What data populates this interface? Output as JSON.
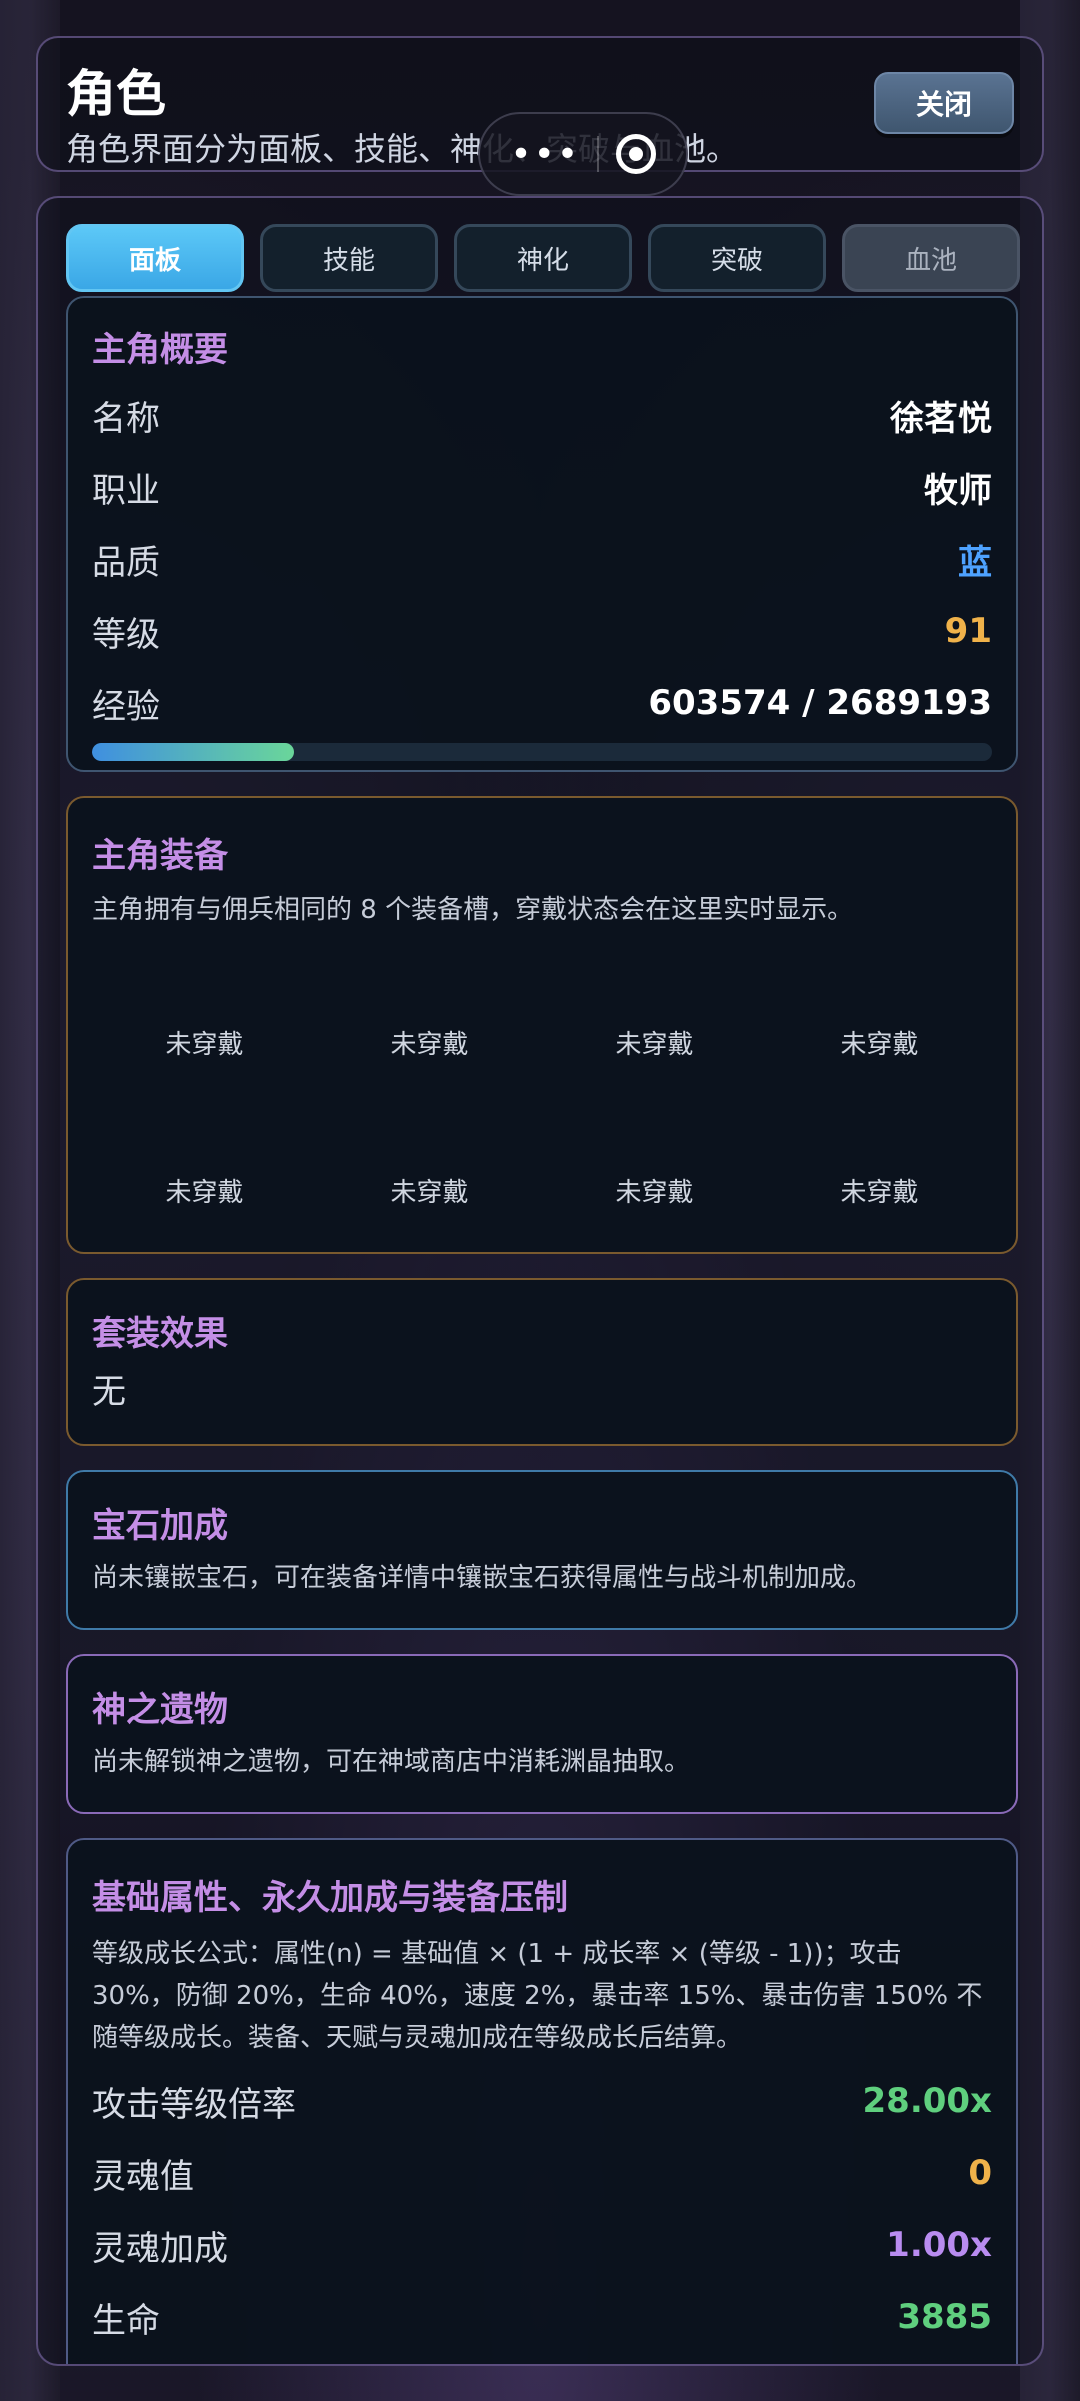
{
  "header": {
    "title": "角色",
    "subtitle": "角色界面分为面板、技能、神化、突破与血池。",
    "close_label": "关闭"
  },
  "capsule": {
    "more_icon": "more-dots-icon",
    "target_icon": "target-icon"
  },
  "tabs": [
    {
      "label": "面板",
      "state": "active"
    },
    {
      "label": "技能",
      "state": "normal"
    },
    {
      "label": "神化",
      "state": "normal"
    },
    {
      "label": "突破",
      "state": "normal"
    },
    {
      "label": "血池",
      "state": "disabled"
    }
  ],
  "overview": {
    "title": "主角概要",
    "rows": [
      {
        "label": "名称",
        "value": "徐茗悦",
        "color": "#ffffff"
      },
      {
        "label": "职业",
        "value": "牧师",
        "color": "#ffffff"
      },
      {
        "label": "品质",
        "value": "蓝",
        "color": "#4ea2ff"
      },
      {
        "label": "等级",
        "value": "91",
        "color": "#f0b24a"
      },
      {
        "label": "经验",
        "value": "603574 / 2689193",
        "color": "#ffffff"
      }
    ],
    "xp_current": 603574,
    "xp_max": 2689193
  },
  "equipment": {
    "title": "主角装备",
    "desc": "主角拥有与佣兵相同的 8 个装备槽，穿戴状态会在这里实时显示。",
    "slots": [
      "未穿戴",
      "未穿戴",
      "未穿戴",
      "未穿戴",
      "未穿戴",
      "未穿戴",
      "未穿戴",
      "未穿戴"
    ]
  },
  "set_effect": {
    "title": "套装效果",
    "value": "无"
  },
  "gem_bonus": {
    "title": "宝石加成",
    "desc": "尚未镶嵌宝石，可在装备详情中镶嵌宝石获得属性与战斗机制加成。"
  },
  "relics": {
    "title": "神之遗物",
    "desc": "尚未解锁神之遗物，可在神域商店中消耗渊晶抽取。"
  },
  "attributes": {
    "title": "基础属性、永久加成与装备压制",
    "desc": "等级成长公式：属性(n) = 基础值 × (1 + 成长率 × (等级 - 1))；攻击 30%，防御 20%，生命 40%，速度 2%，暴击率 15%、暴击伤害 150% 不随等级成长。装备、天赋与灵魂加成在等级成长后结算。",
    "rows": [
      {
        "label": "攻击等级倍率",
        "value": "28.00x",
        "color": "#5fcf7e"
      },
      {
        "label": "灵魂值",
        "value": "0",
        "color": "#f0b24a"
      },
      {
        "label": "灵魂加成",
        "value": "1.00x",
        "color": "#b98cf0"
      },
      {
        "label": "生命",
        "value": "3885",
        "color": "#5fcf7e"
      }
    ]
  },
  "colors": {
    "card_border_overview": "#3f5570",
    "card_border_equipment": "#7a5a2e",
    "card_border_set": "#7a5a2e",
    "card_border_gem": "#3f7aa8",
    "card_border_relic": "#8a6ab8",
    "card_border_attr": "#4f5a86"
  }
}
